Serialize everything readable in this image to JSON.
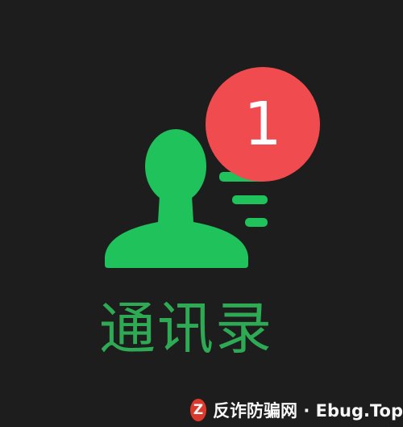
{
  "tab": {
    "label": "通讯录",
    "icon": "contacts-icon",
    "badge_count": "1"
  },
  "watermark": {
    "logo_letter": "Z",
    "text": "反诈防骗网 · Ebug.Top"
  },
  "colors": {
    "background": "#1d1d1d",
    "icon_green": "#1fc25b",
    "label_green": "#2eaa55",
    "badge_red": "#f04b4f"
  }
}
